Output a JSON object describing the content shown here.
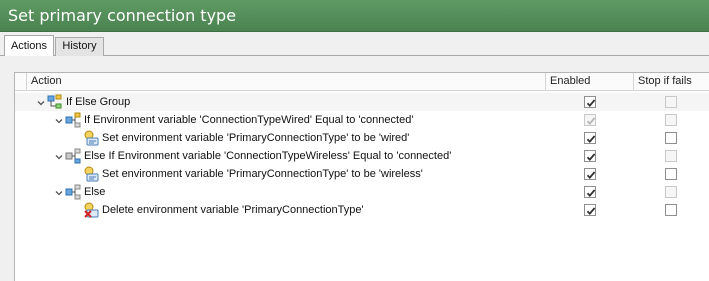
{
  "window": {
    "title": "Set primary connection type"
  },
  "tabs": [
    {
      "label": "Actions",
      "active": true
    },
    {
      "label": "History",
      "active": false
    }
  ],
  "table": {
    "columns": [
      "Action",
      "Enabled",
      "Stop if fails"
    ],
    "rows": [
      {
        "label": "If Else Group",
        "level": 0,
        "icon": "if-else-group-icon",
        "expanded": true,
        "enabled": true,
        "enabled_disabled": false,
        "stop_if_fails": false,
        "stop_disabled": true,
        "bold": true
      },
      {
        "label": "If Environment variable 'ConnectionTypeWired' Equal to 'connected'",
        "level": 1,
        "icon": "if-branch-icon",
        "expanded": true,
        "enabled": true,
        "enabled_disabled": true,
        "stop_if_fails": false,
        "stop_disabled": true
      },
      {
        "label": "Set environment variable 'PrimaryConnectionType' to be 'wired'",
        "level": 2,
        "icon": "set-variable-icon",
        "expanded": null,
        "enabled": true,
        "enabled_disabled": false,
        "stop_if_fails": false,
        "stop_disabled": false
      },
      {
        "label": "Else If Environment variable 'ConnectionTypeWireless' Equal to 'connected'",
        "level": 1,
        "icon": "else-if-branch-icon",
        "expanded": true,
        "enabled": true,
        "enabled_disabled": false,
        "stop_if_fails": false,
        "stop_disabled": true
      },
      {
        "label": "Set environment variable 'PrimaryConnectionType' to be 'wireless'",
        "level": 2,
        "icon": "set-variable-icon",
        "expanded": null,
        "enabled": true,
        "enabled_disabled": false,
        "stop_if_fails": false,
        "stop_disabled": false
      },
      {
        "label": "Else",
        "level": 1,
        "icon": "else-branch-icon",
        "expanded": true,
        "enabled": true,
        "enabled_disabled": false,
        "stop_if_fails": false,
        "stop_disabled": true
      },
      {
        "label": "Delete environment variable 'PrimaryConnectionType'",
        "level": 2,
        "icon": "delete-variable-icon",
        "expanded": null,
        "enabled": true,
        "enabled_disabled": false,
        "stop_if_fails": false,
        "stop_disabled": false
      }
    ]
  },
  "colors": {
    "title_bar": "#4e8a54",
    "title_text": "#ffffff",
    "check": "#333333",
    "check_disabled": "#b5b5b5"
  }
}
